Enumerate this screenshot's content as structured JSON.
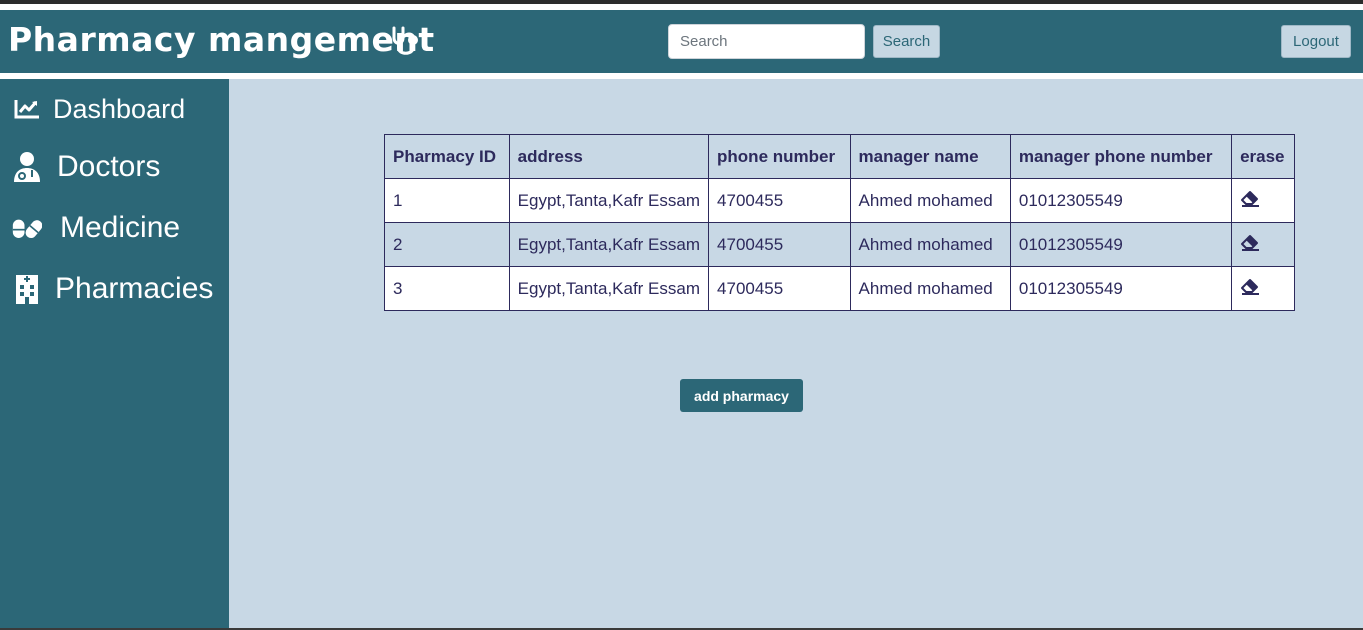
{
  "header": {
    "brand": "Pharmacy mangement",
    "brand_icon": "stethoscope-icon",
    "search_placeholder": "Search",
    "search_button": "Search",
    "logout_button": "Logout"
  },
  "sidebar": {
    "items": [
      {
        "label": "Dashboard",
        "icon": "chart-line-icon"
      },
      {
        "label": "Doctors",
        "icon": "doctor-icon"
      },
      {
        "label": "Medicine",
        "icon": "pills-icon"
      },
      {
        "label": "Pharmacies",
        "icon": "hospital-building-icon"
      }
    ]
  },
  "table": {
    "columns": [
      "Pharmacy ID",
      "address",
      "phone number",
      "manager name",
      "manager phone number",
      "erase"
    ],
    "rows": [
      {
        "id": "1",
        "address": "Egypt,Tanta,Kafr Essam",
        "phone": "4700455",
        "manager": "Ahmed mohamed",
        "manager_phone": "01012305549",
        "erase_icon": "eraser-icon"
      },
      {
        "id": "2",
        "address": "Egypt,Tanta,Kafr Essam",
        "phone": "4700455",
        "manager": "Ahmed mohamed",
        "manager_phone": "01012305549",
        "erase_icon": "eraser-icon"
      },
      {
        "id": "3",
        "address": "Egypt,Tanta,Kafr Essam",
        "phone": "4700455",
        "manager": "Ahmed mohamed",
        "manager_phone": "01012305549",
        "erase_icon": "eraser-icon"
      }
    ]
  },
  "add_button": "add pharmacy",
  "colors": {
    "primary": "#2c6777",
    "content_bg": "#c8d8e5",
    "table_text": "#2d2a5c",
    "button_light": "#c6d7e3"
  }
}
